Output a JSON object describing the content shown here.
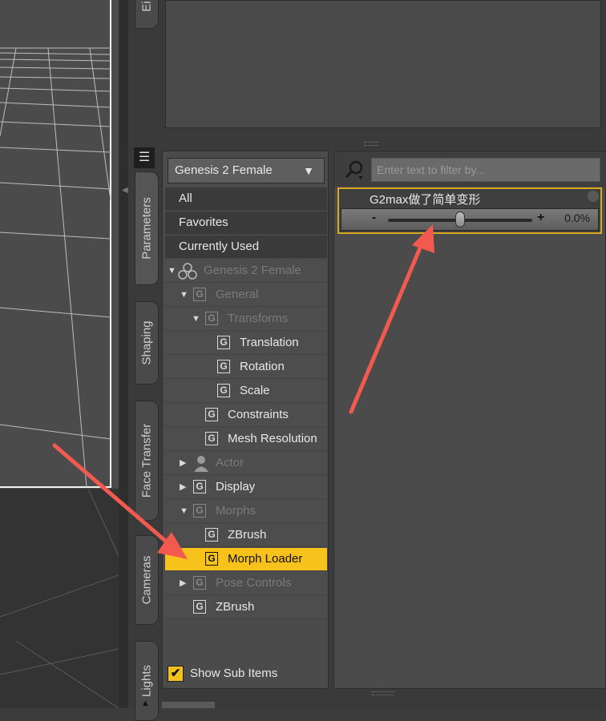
{
  "tabs": {
    "partial_top": "Ei",
    "parameters": "Parameters",
    "shaping": "Shaping",
    "face_transfer": "Face Transfer",
    "cameras": "Cameras",
    "lights": "Lights"
  },
  "tree": {
    "node_dropdown": "Genesis 2 Female",
    "filters": [
      "All",
      "Favorites",
      "Currently Used"
    ],
    "items": {
      "root": "Genesis 2 Female",
      "general": "General",
      "transforms": "Transforms",
      "translation": "Translation",
      "rotation": "Rotation",
      "scale": "Scale",
      "constraints": "Constraints",
      "mesh_resolution": "Mesh Resolution",
      "actor": "Actor",
      "display": "Display",
      "morphs": "Morphs",
      "zbrush_sub": "ZBrush",
      "morph_loader": "Morph Loader",
      "pose_controls": "Pose Controls",
      "zbrush": "ZBrush"
    },
    "show_sub_items": "Show Sub Items",
    "show_sub_items_checked": true,
    "g_icon_letter": "G"
  },
  "params": {
    "filter_placeholder": "Enter text to filter by...",
    "slider": {
      "name": "G2max做了简单变形",
      "minus": "-",
      "plus": "+",
      "value_text": "0.0%",
      "value_fraction": 0.5
    }
  },
  "colors": {
    "selection": "#f7c21c",
    "annotation_arrow": "#f25a50"
  }
}
